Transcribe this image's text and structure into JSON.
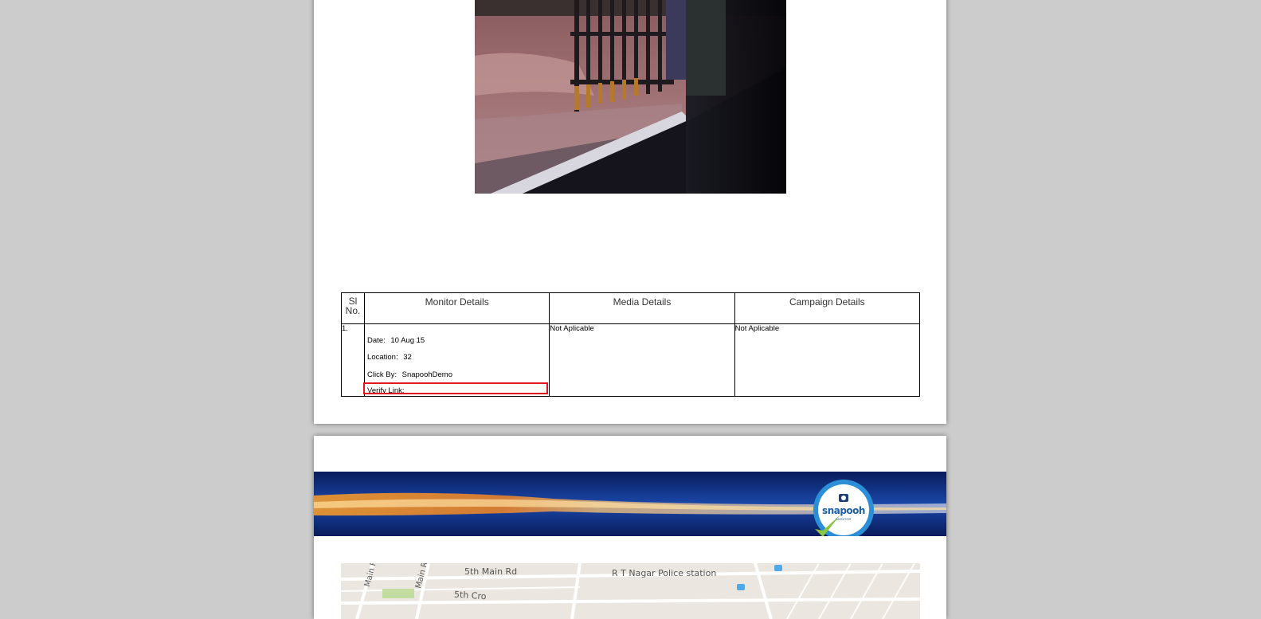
{
  "table": {
    "headers": {
      "sl_line1": "Sl",
      "sl_line2": "No.",
      "monitor": "Monitor Details",
      "media": "Media Details",
      "campaign": "Campaign Details"
    },
    "rows": [
      {
        "sno": "1.",
        "date_label": "Date:",
        "date_value": "10 Aug 15",
        "location_label": "Location:",
        "location_value": "32",
        "click_by_label": "Click By:",
        "click_by_value": "SnapoohDemo",
        "verify_label": "Verify Link:",
        "media": "Not Aplicable",
        "campaign": "Not Aplicable"
      }
    ]
  },
  "logo": {
    "text": "snapooh",
    "subtext": "MONITOR"
  },
  "map": {
    "labels": {
      "road1": "5th Main Rd",
      "police": "R T Nagar Police station",
      "road2": "Main Rd",
      "road3": "Main Rd",
      "road4": "5th Cro"
    }
  },
  "colors": {
    "highlight": "#e3141b",
    "banner_dark": "#0a1b5c",
    "logo_blue": "#1f5fa8"
  }
}
